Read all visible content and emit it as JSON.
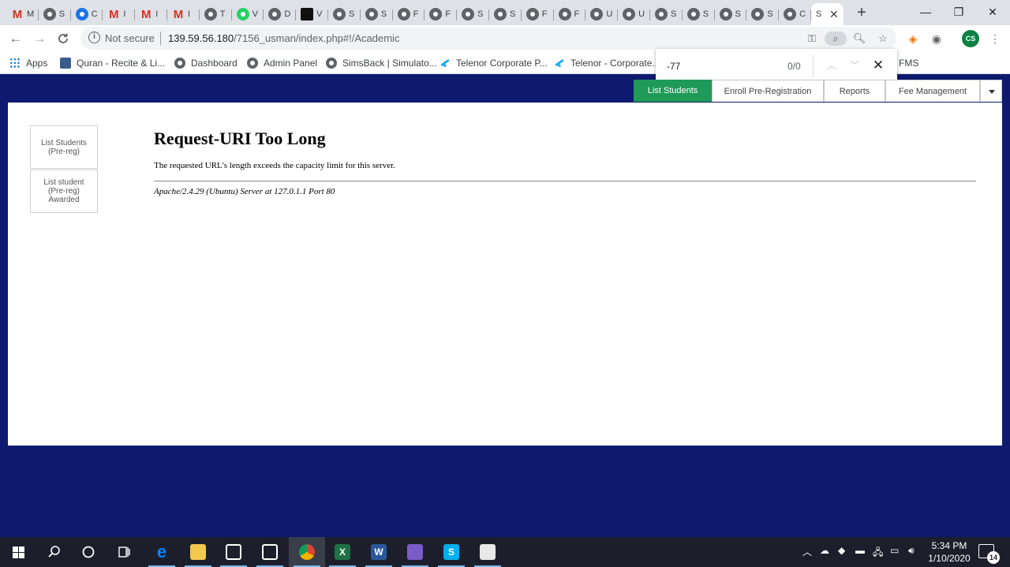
{
  "browser": {
    "tabs": [
      {
        "icon": "gmail-icon",
        "title": "M"
      },
      {
        "icon": "chrome-icon",
        "title": "S"
      },
      {
        "icon": "account-icon",
        "title": "C"
      },
      {
        "icon": "gmail-icon",
        "title": "I"
      },
      {
        "icon": "gmail-icon",
        "title": "I"
      },
      {
        "icon": "gmail-icon",
        "title": "I"
      },
      {
        "icon": "chrome-icon",
        "title": "T"
      },
      {
        "icon": "whatsapp-icon",
        "title": "V"
      },
      {
        "icon": "chrome-icon",
        "title": "D"
      },
      {
        "icon": "dark-site-icon",
        "title": "V"
      },
      {
        "icon": "chrome-icon",
        "title": "S"
      },
      {
        "icon": "chrome-icon",
        "title": "S"
      },
      {
        "icon": "chrome-icon",
        "title": "F"
      },
      {
        "icon": "chrome-icon",
        "title": "F"
      },
      {
        "icon": "chrome-icon",
        "title": "S"
      },
      {
        "icon": "chrome-icon",
        "title": "S"
      },
      {
        "icon": "chrome-icon",
        "title": "F"
      },
      {
        "icon": "chrome-icon",
        "title": "F"
      },
      {
        "icon": "chrome-icon",
        "title": "U"
      },
      {
        "icon": "chrome-icon",
        "title": "U"
      },
      {
        "icon": "chrome-icon",
        "title": "S"
      },
      {
        "icon": "chrome-icon",
        "title": "S"
      },
      {
        "icon": "chrome-icon",
        "title": "S"
      },
      {
        "icon": "chrome-icon",
        "title": "S"
      },
      {
        "icon": "chrome-icon",
        "title": "C"
      }
    ],
    "active_tab_title": "S",
    "active_tab_close": "✕",
    "new_tab": "+",
    "window_controls": {
      "minimize": "—",
      "restore": "❐",
      "close": "✕"
    },
    "nav": {
      "back": "←",
      "forward": "→",
      "reload": "C"
    },
    "address": {
      "security_icon": "i",
      "security_label": "Not secure",
      "host": "139.59.56.180",
      "path": "/7156_usman/index.php#!/Academic"
    },
    "profile_initials": "CS",
    "bookmarks": [
      {
        "icon": "grid",
        "label": "Apps"
      },
      {
        "icon": "quran",
        "label": "Quran - Recite & Li..."
      },
      {
        "icon": "globe",
        "label": "Dashboard"
      },
      {
        "icon": "globe",
        "label": "Admin Panel"
      },
      {
        "icon": "globe",
        "label": "SimsBack | Simulato..."
      },
      {
        "icon": "tel",
        "label": "Telenor Corporate P..."
      },
      {
        "icon": "tel",
        "label": "Telenor - Corporate..."
      },
      {
        "icon": "globe",
        "label": "FMS"
      }
    ],
    "find": {
      "query": "-77",
      "count": "0/0",
      "prev": "︿",
      "next": "﹀",
      "close": "✕"
    }
  },
  "app": {
    "tabs": [
      {
        "label": "List Students",
        "active": true
      },
      {
        "label": "Enroll Pre-Registration",
        "active": false
      },
      {
        "label": "Reports",
        "active": false
      },
      {
        "label": "Fee Management",
        "active": false
      }
    ],
    "sidebar": [
      {
        "label": "List Students (Pre-reg)"
      },
      {
        "label": "List student (Pre-reg) Awarded"
      }
    ],
    "error": {
      "title": "Request-URI Too Long",
      "message": "The requested URL's length exceeds the capacity limit for this server.",
      "address": "Apache/2.4.29 (Ubuntu) Server at 127.0.1.1 Port 80"
    }
  },
  "taskbar": {
    "clock_time": "5:34 PM",
    "clock_date": "1/10/2020",
    "notification_count": "14",
    "apps": [
      {
        "name": "edge",
        "label": "e"
      },
      {
        "name": "file-explorer",
        "label": ""
      },
      {
        "name": "store",
        "label": ""
      },
      {
        "name": "mail",
        "label": ""
      },
      {
        "name": "chrome",
        "label": ""
      },
      {
        "name": "excel",
        "label": "X"
      },
      {
        "name": "word",
        "label": "W"
      },
      {
        "name": "dolphin",
        "label": ""
      },
      {
        "name": "skype",
        "label": "S"
      },
      {
        "name": "paint",
        "label": ""
      }
    ]
  }
}
